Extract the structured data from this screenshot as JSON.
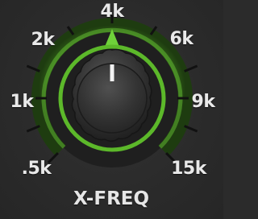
{
  "control": {
    "title": "X-FREQ",
    "value_label": "4k",
    "accent_color": "#5cb82a",
    "scale_labels": [
      ".5k",
      "1k",
      "2k",
      "4k",
      "6k",
      "9k",
      "15k"
    ]
  }
}
